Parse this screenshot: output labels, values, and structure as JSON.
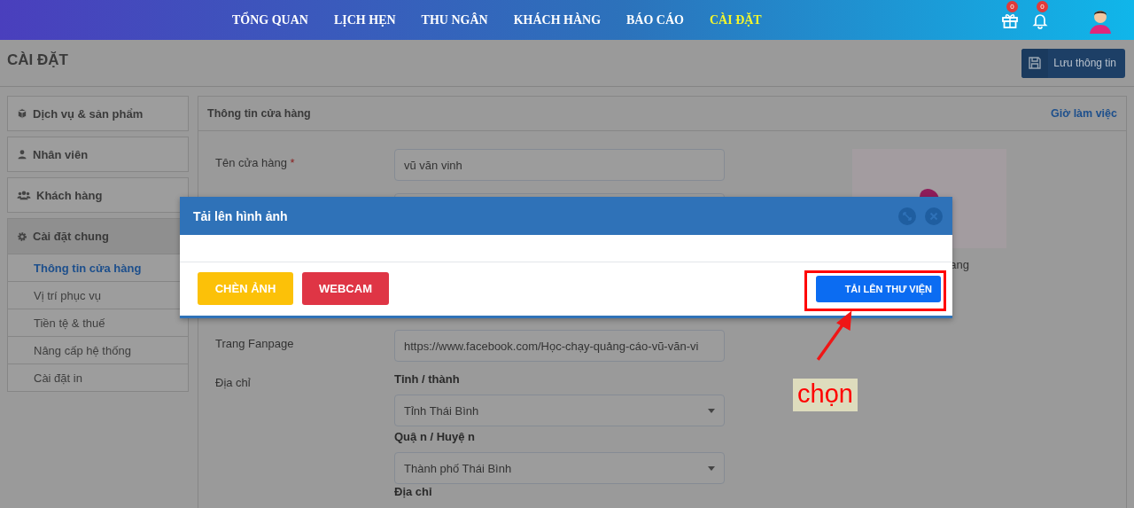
{
  "header": {
    "nav": [
      {
        "label": "TỔNG QUAN",
        "selected": false
      },
      {
        "label": "LỊCH HẸN",
        "selected": false
      },
      {
        "label": "THU NGÂN",
        "selected": false
      },
      {
        "label": "KHÁCH HÀNG",
        "selected": false
      },
      {
        "label": "BÁO CÁO",
        "selected": false
      },
      {
        "label": "CÀI ĐẶT",
        "selected": true
      }
    ],
    "gift_count": "0",
    "bell_count": "0"
  },
  "page_title": "CÀI ĐẶT",
  "save_button": "Lưu thông tin",
  "sidebar": [
    {
      "label": "Dịch vụ & sản phẩm",
      "expanded": false
    },
    {
      "label": "Nhân viên",
      "expanded": false
    },
    {
      "label": "Khách hàng",
      "expanded": false
    },
    {
      "label": "Cài đặt chung",
      "expanded": true,
      "children": [
        {
          "label": "Thông tin cửa hàng",
          "selected": true
        },
        {
          "label": "Vị trí phục vụ",
          "selected": false
        },
        {
          "label": "Tiền tệ & thuế",
          "selected": false
        },
        {
          "label": "Nâng cấp hệ thống",
          "selected": false
        },
        {
          "label": "Cài đặt in",
          "selected": false
        }
      ]
    }
  ],
  "panel": {
    "title": "Thông tin cửa hàng",
    "link": "Giờ làm việc",
    "store_name": {
      "label": "Tên cửa hàng",
      "required": true,
      "required_mark": "*",
      "value": "vũ văn vinh"
    },
    "fanpage": {
      "label": "Trang Fanpage",
      "value": "https://www.facebook.com/Học-chạy-quảng-cáo-vũ-văn-vi"
    },
    "address": {
      "label": "Địa chỉ",
      "parts": [
        {
          "label": "Tỉnh / thành",
          "value": "Tỉnh Thái Bình"
        },
        {
          "label": "Quậ n / Huyệ n",
          "value": "Thành phố Thái Bình"
        },
        {
          "label": "Địa chỉ"
        }
      ]
    },
    "image_caption": "ang"
  },
  "modal": {
    "title": "Tải lên hình ảnh",
    "buttons": [
      {
        "label": "CHÈN ẢNH",
        "kind": "warning"
      },
      {
        "label": "WEBCAM",
        "kind": "danger"
      },
      {
        "label": "TẢI LÊN THƯ VIỆN",
        "kind": "primary"
      }
    ]
  },
  "annotation": {
    "label": "chọn"
  }
}
